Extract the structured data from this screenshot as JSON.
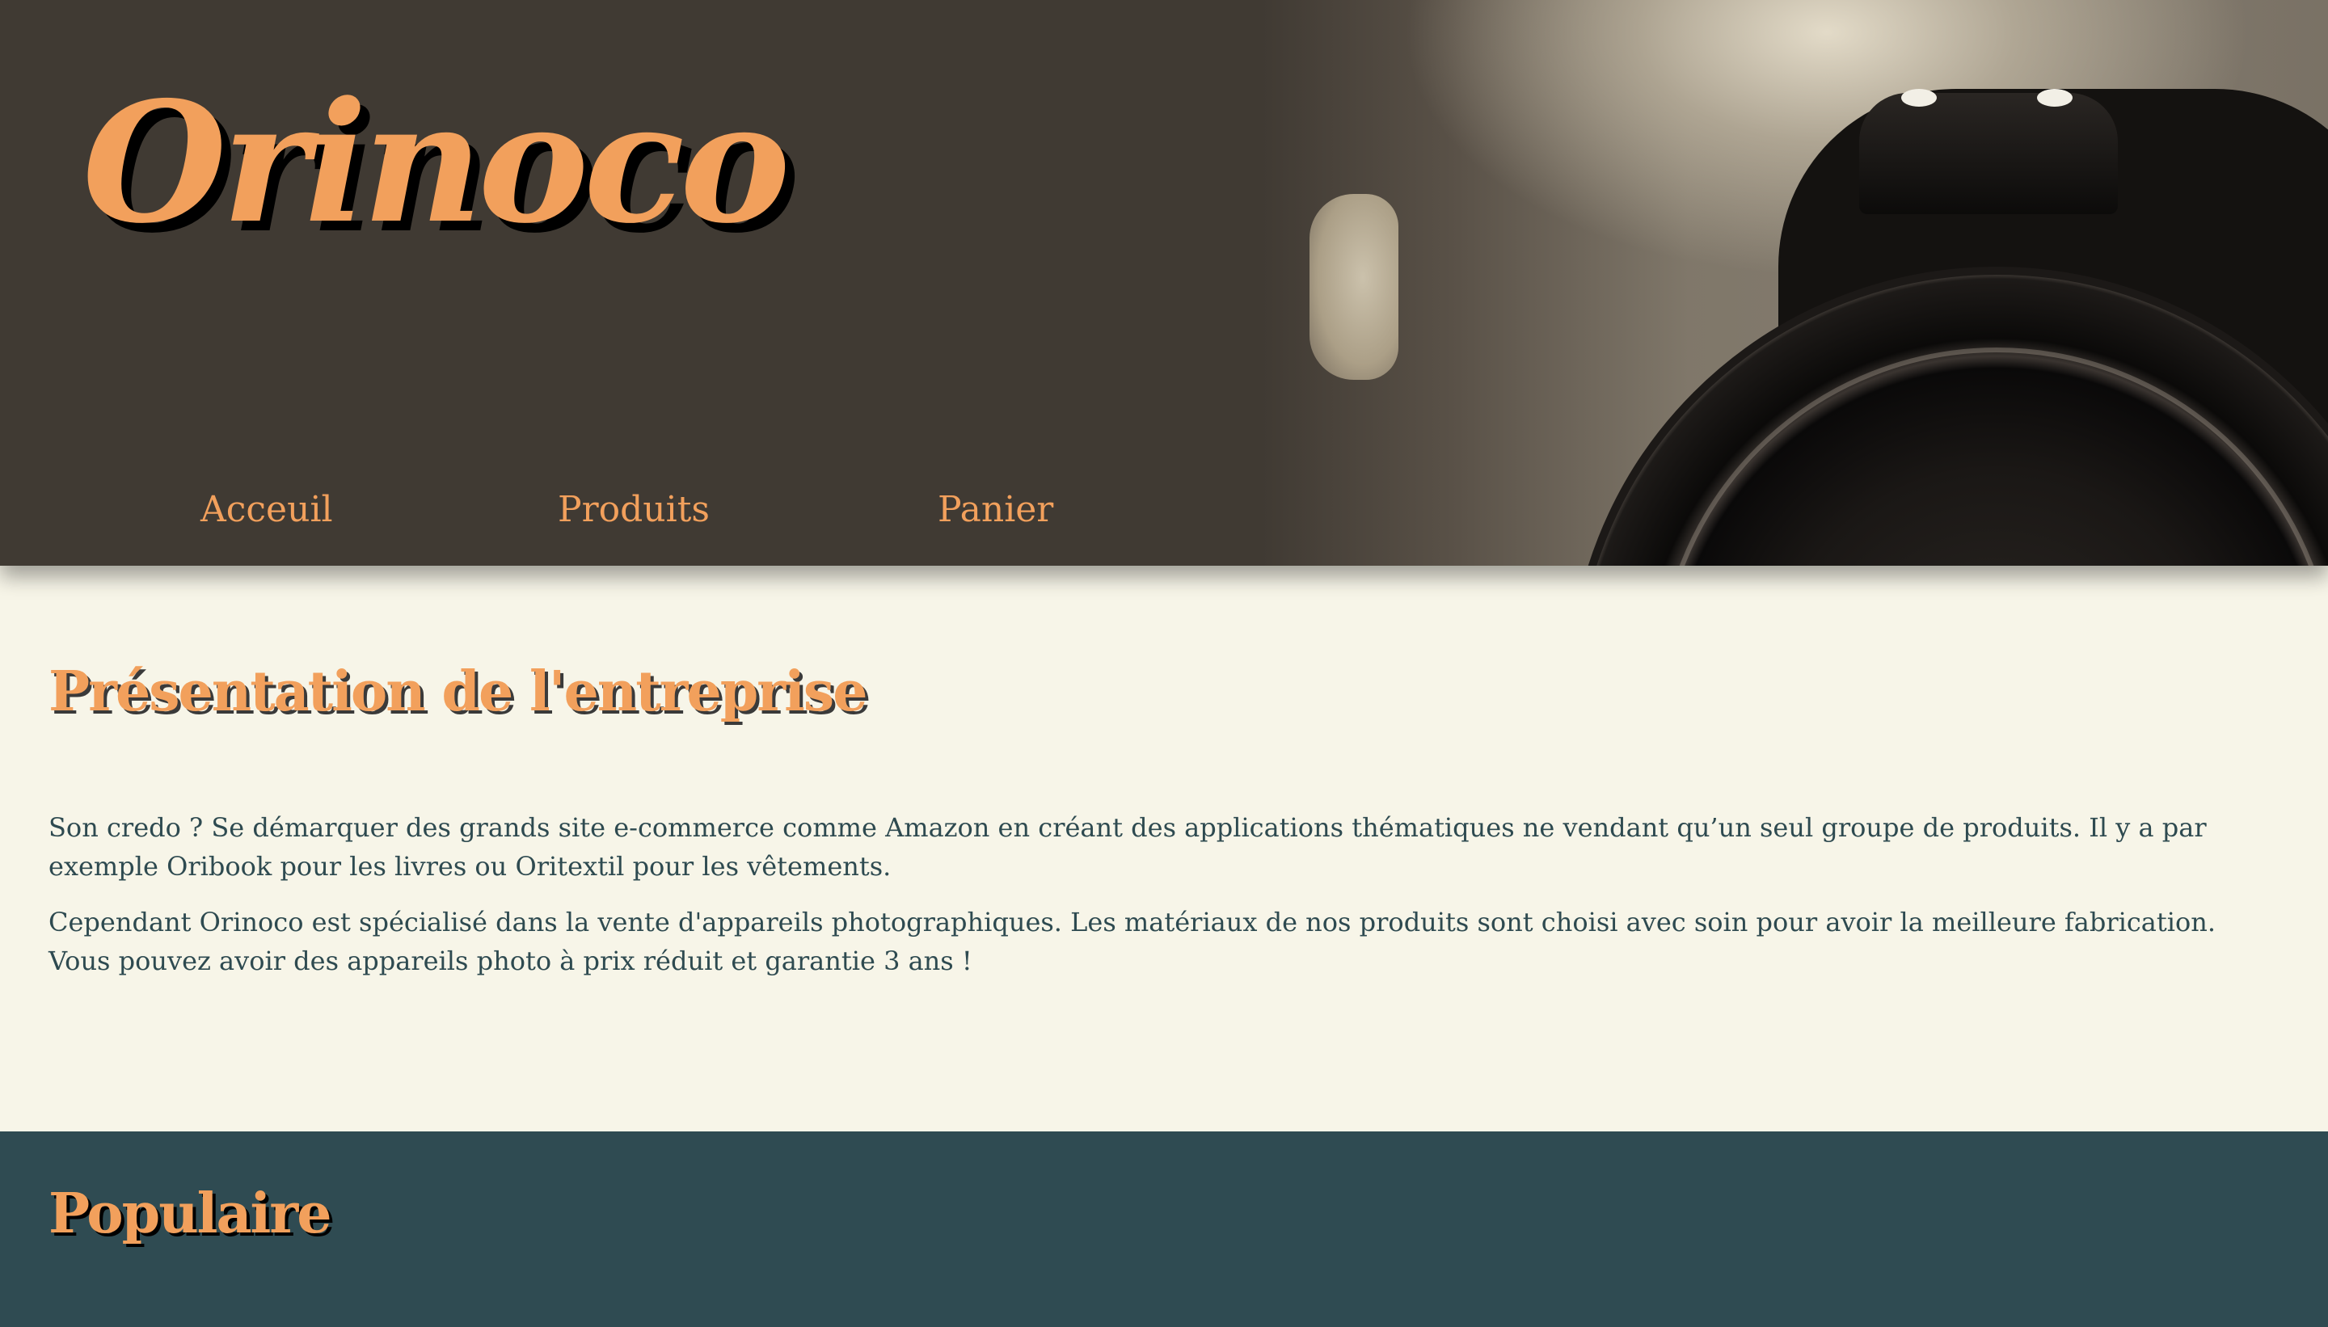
{
  "header": {
    "logo": "Orinoco",
    "nav": [
      {
        "label": "Acceuil"
      },
      {
        "label": "Produits"
      },
      {
        "label": "Panier"
      }
    ]
  },
  "presentation": {
    "title": "Présentation de l'entreprise",
    "paragraphs": [
      "Son credo ? Se démarquer des grands site e-commerce comme Amazon en créant des applications thématiques ne vendant qu’un seul groupe de produits. Il y a par exemple Oribook pour les livres ou Oritextil pour les vêtements.",
      "Cependant Orinoco est spécialisé dans la vente d'appareils photographiques. Les matériaux de nos produits sont choisi avec soin pour avoir la meilleure fabrication. Vous pouvez avoir des appareils photo à prix réduit et garantie 3 ans !"
    ]
  },
  "populaire": {
    "title": "Populaire"
  },
  "colors": {
    "accent": "#f2a05c",
    "header_bg": "#403a33",
    "page_bg": "#f7f5e8",
    "text": "#2e4a50",
    "populaire_bg": "#2f4b52"
  }
}
